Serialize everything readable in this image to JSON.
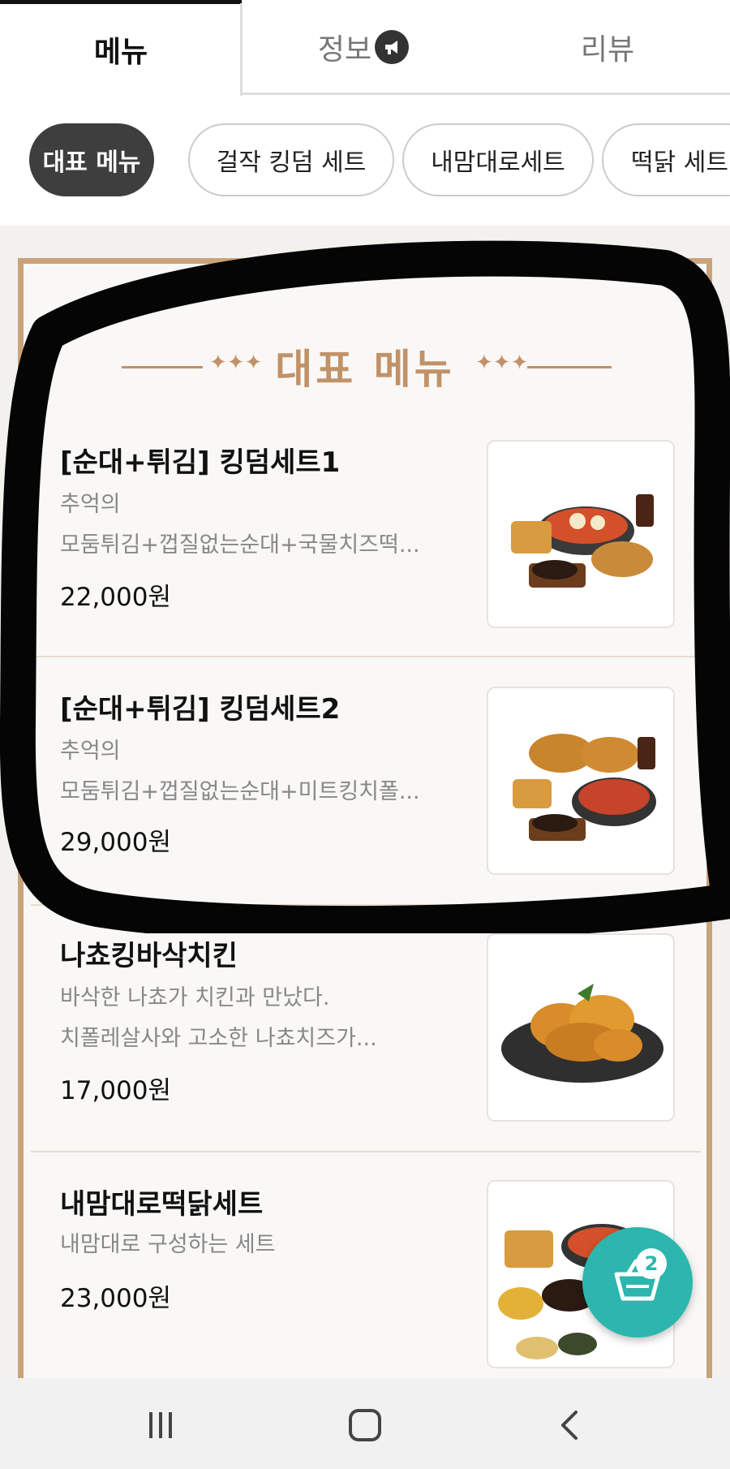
{
  "tabs": [
    {
      "label": "메뉴",
      "active": true
    },
    {
      "label": "정보",
      "icon": "megaphone-icon"
    },
    {
      "label": "리뷰"
    }
  ],
  "chips": [
    {
      "label": "대표 메뉴",
      "active": true
    },
    {
      "label": "걸작 킹덤 세트"
    },
    {
      "label": "내맘대로세트"
    },
    {
      "label": "떡닭 세트"
    }
  ],
  "section": {
    "title": "대표 메뉴"
  },
  "items": [
    {
      "title": "[순대+튀김] 킹덤세트1",
      "desc1": "추억의",
      "desc2": "모둠튀김+껍질없는순대+국물치즈떡...",
      "price": "22,000원",
      "image": "set-meal-photo"
    },
    {
      "title": "[순대+튀김] 킹덤세트2",
      "desc1": "추억의",
      "desc2": "모둠튀김+껍질없는순대+미트킹치폴...",
      "price": "29,000원",
      "image": "set-meal-photo"
    },
    {
      "title": "나쵸킹바삭치킨",
      "desc1": "바삭한 나쵸가 치킨과 만났다.",
      "desc2": "치폴레살사와 고소한 나쵸치즈가...",
      "price": "17,000원",
      "image": "fried-chicken-photo"
    },
    {
      "title": "내맘대로떡닭세트",
      "desc1": "내맘대로 구성하는 세트",
      "desc2": "",
      "price": "23,000원",
      "image": "set-meal-photo"
    }
  ],
  "cart": {
    "count": "2",
    "icon": "basket-icon"
  },
  "colors": {
    "accent": "#2cb6ad",
    "gold": "#c19268",
    "active_chip": "#3e3e3e"
  },
  "navbar": {
    "icons": [
      "recent-apps-icon",
      "home-icon",
      "back-icon"
    ]
  }
}
